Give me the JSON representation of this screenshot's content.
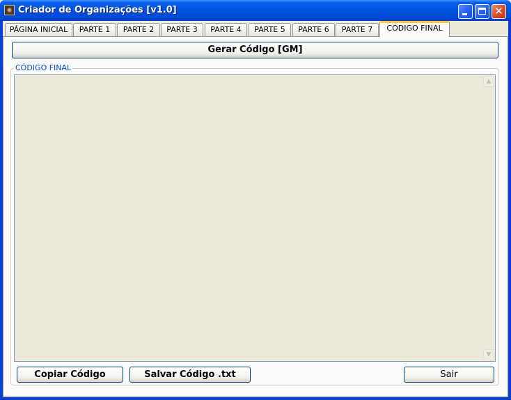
{
  "window": {
    "title": "Criador de Organizações [v1.0]",
    "icon": "app-emblem-icon",
    "controls": {
      "minimize": "minimize-icon",
      "maximize": "maximize-icon",
      "close": "✕"
    }
  },
  "tabs": [
    {
      "label": "PÁGINA INICIAL",
      "active": false
    },
    {
      "label": "PARTE 1",
      "active": false
    },
    {
      "label": "PARTE 2",
      "active": false
    },
    {
      "label": "PARTE 3",
      "active": false
    },
    {
      "label": "PARTE 4",
      "active": false
    },
    {
      "label": "PARTE 5",
      "active": false
    },
    {
      "label": "PARTE 6",
      "active": false
    },
    {
      "label": "PARTE 7",
      "active": false
    },
    {
      "label": "CÓDIGO FINAL",
      "active": true
    }
  ],
  "main": {
    "generate_label": "Gerar Código [GM]",
    "group_title": "CÓDIGO FINAL",
    "code_value": ""
  },
  "buttons": {
    "copy_label": "Copiar Código",
    "save_label": "Salvar Código .txt",
    "exit_label": "Sair"
  },
  "colors": {
    "titlebar": "#0054e3",
    "active_tab_accent": "#ffc83c",
    "group_title": "#0046d5",
    "code_area_bg": "#ece9d8"
  }
}
